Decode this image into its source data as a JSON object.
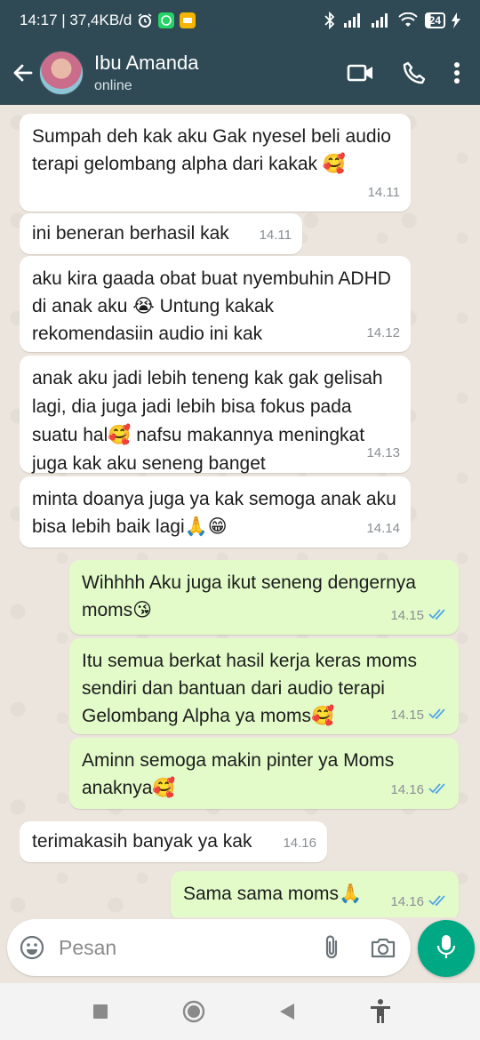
{
  "status_bar": {
    "time_speed": "14:17 | 37,4KB/d",
    "battery": "24",
    "icons": [
      "alarm-icon",
      "whatsapp-icon",
      "app-icon",
      "bluetooth-icon",
      "signal-icon",
      "signal-icon",
      "wifi-icon",
      "battery-icon",
      "charging-icon"
    ]
  },
  "header": {
    "name": "Ibu Amanda",
    "status": "online",
    "icons": [
      "back-arrow-icon",
      "video-call-icon",
      "phone-call-icon",
      "more-vert-icon"
    ]
  },
  "messages": [
    {
      "dir": "in",
      "text": "Sumpah deh kak aku Gak nyesel beli audio terapi gelombang alpha dari kakak 🥰",
      "time": "14.11"
    },
    {
      "dir": "in",
      "text": "ini beneran berhasil kak",
      "time": "14.11"
    },
    {
      "dir": "in",
      "text": "aku kira gaada obat buat nyembuhin ADHD di anak aku 😭 Untung kakak rekomendasiin audio ini kak",
      "time": "14.12"
    },
    {
      "dir": "in",
      "text": "anak aku jadi lebih teneng kak gak gelisah lagi, dia juga jadi lebih bisa fokus pada suatu hal🥰 nafsu makannya meningkat juga kak aku seneng banget",
      "time": "14.13"
    },
    {
      "dir": "in",
      "text": "minta doanya juga ya kak semoga anak aku bisa lebih baik lagi🙏😁",
      "time": "14.14"
    },
    {
      "dir": "out",
      "text": "Wihhhh Aku juga ikut seneng dengernya moms😘",
      "time": "14.15"
    },
    {
      "dir": "out",
      "text": "Itu semua berkat hasil kerja keras moms sendiri dan bantuan dari audio terapi Gelombang Alpha ya moms🥰",
      "time": "14.15"
    },
    {
      "dir": "out",
      "text": "Aminn semoga makin pinter ya Moms anaknya🥰",
      "time": "14.16"
    },
    {
      "dir": "in",
      "text": "terimakasih banyak ya kak",
      "time": "14.16"
    },
    {
      "dir": "out",
      "text": "Sama sama moms🙏",
      "time": "14.16"
    }
  ],
  "input": {
    "placeholder": "Pesan",
    "icons": [
      "emoji-icon",
      "attach-icon",
      "camera-icon",
      "mic-icon"
    ]
  },
  "nav": {
    "icons": [
      "recent-apps-icon",
      "home-icon",
      "back-icon",
      "accessibility-icon"
    ]
  },
  "colors": {
    "header_bg": "#2f4a55",
    "incoming_bubble": "#ffffff",
    "outgoing_bubble": "#e2fbc9",
    "read_tick": "#53a6e6",
    "mic_button": "#00a884",
    "chat_bg": "#ece5dd"
  }
}
